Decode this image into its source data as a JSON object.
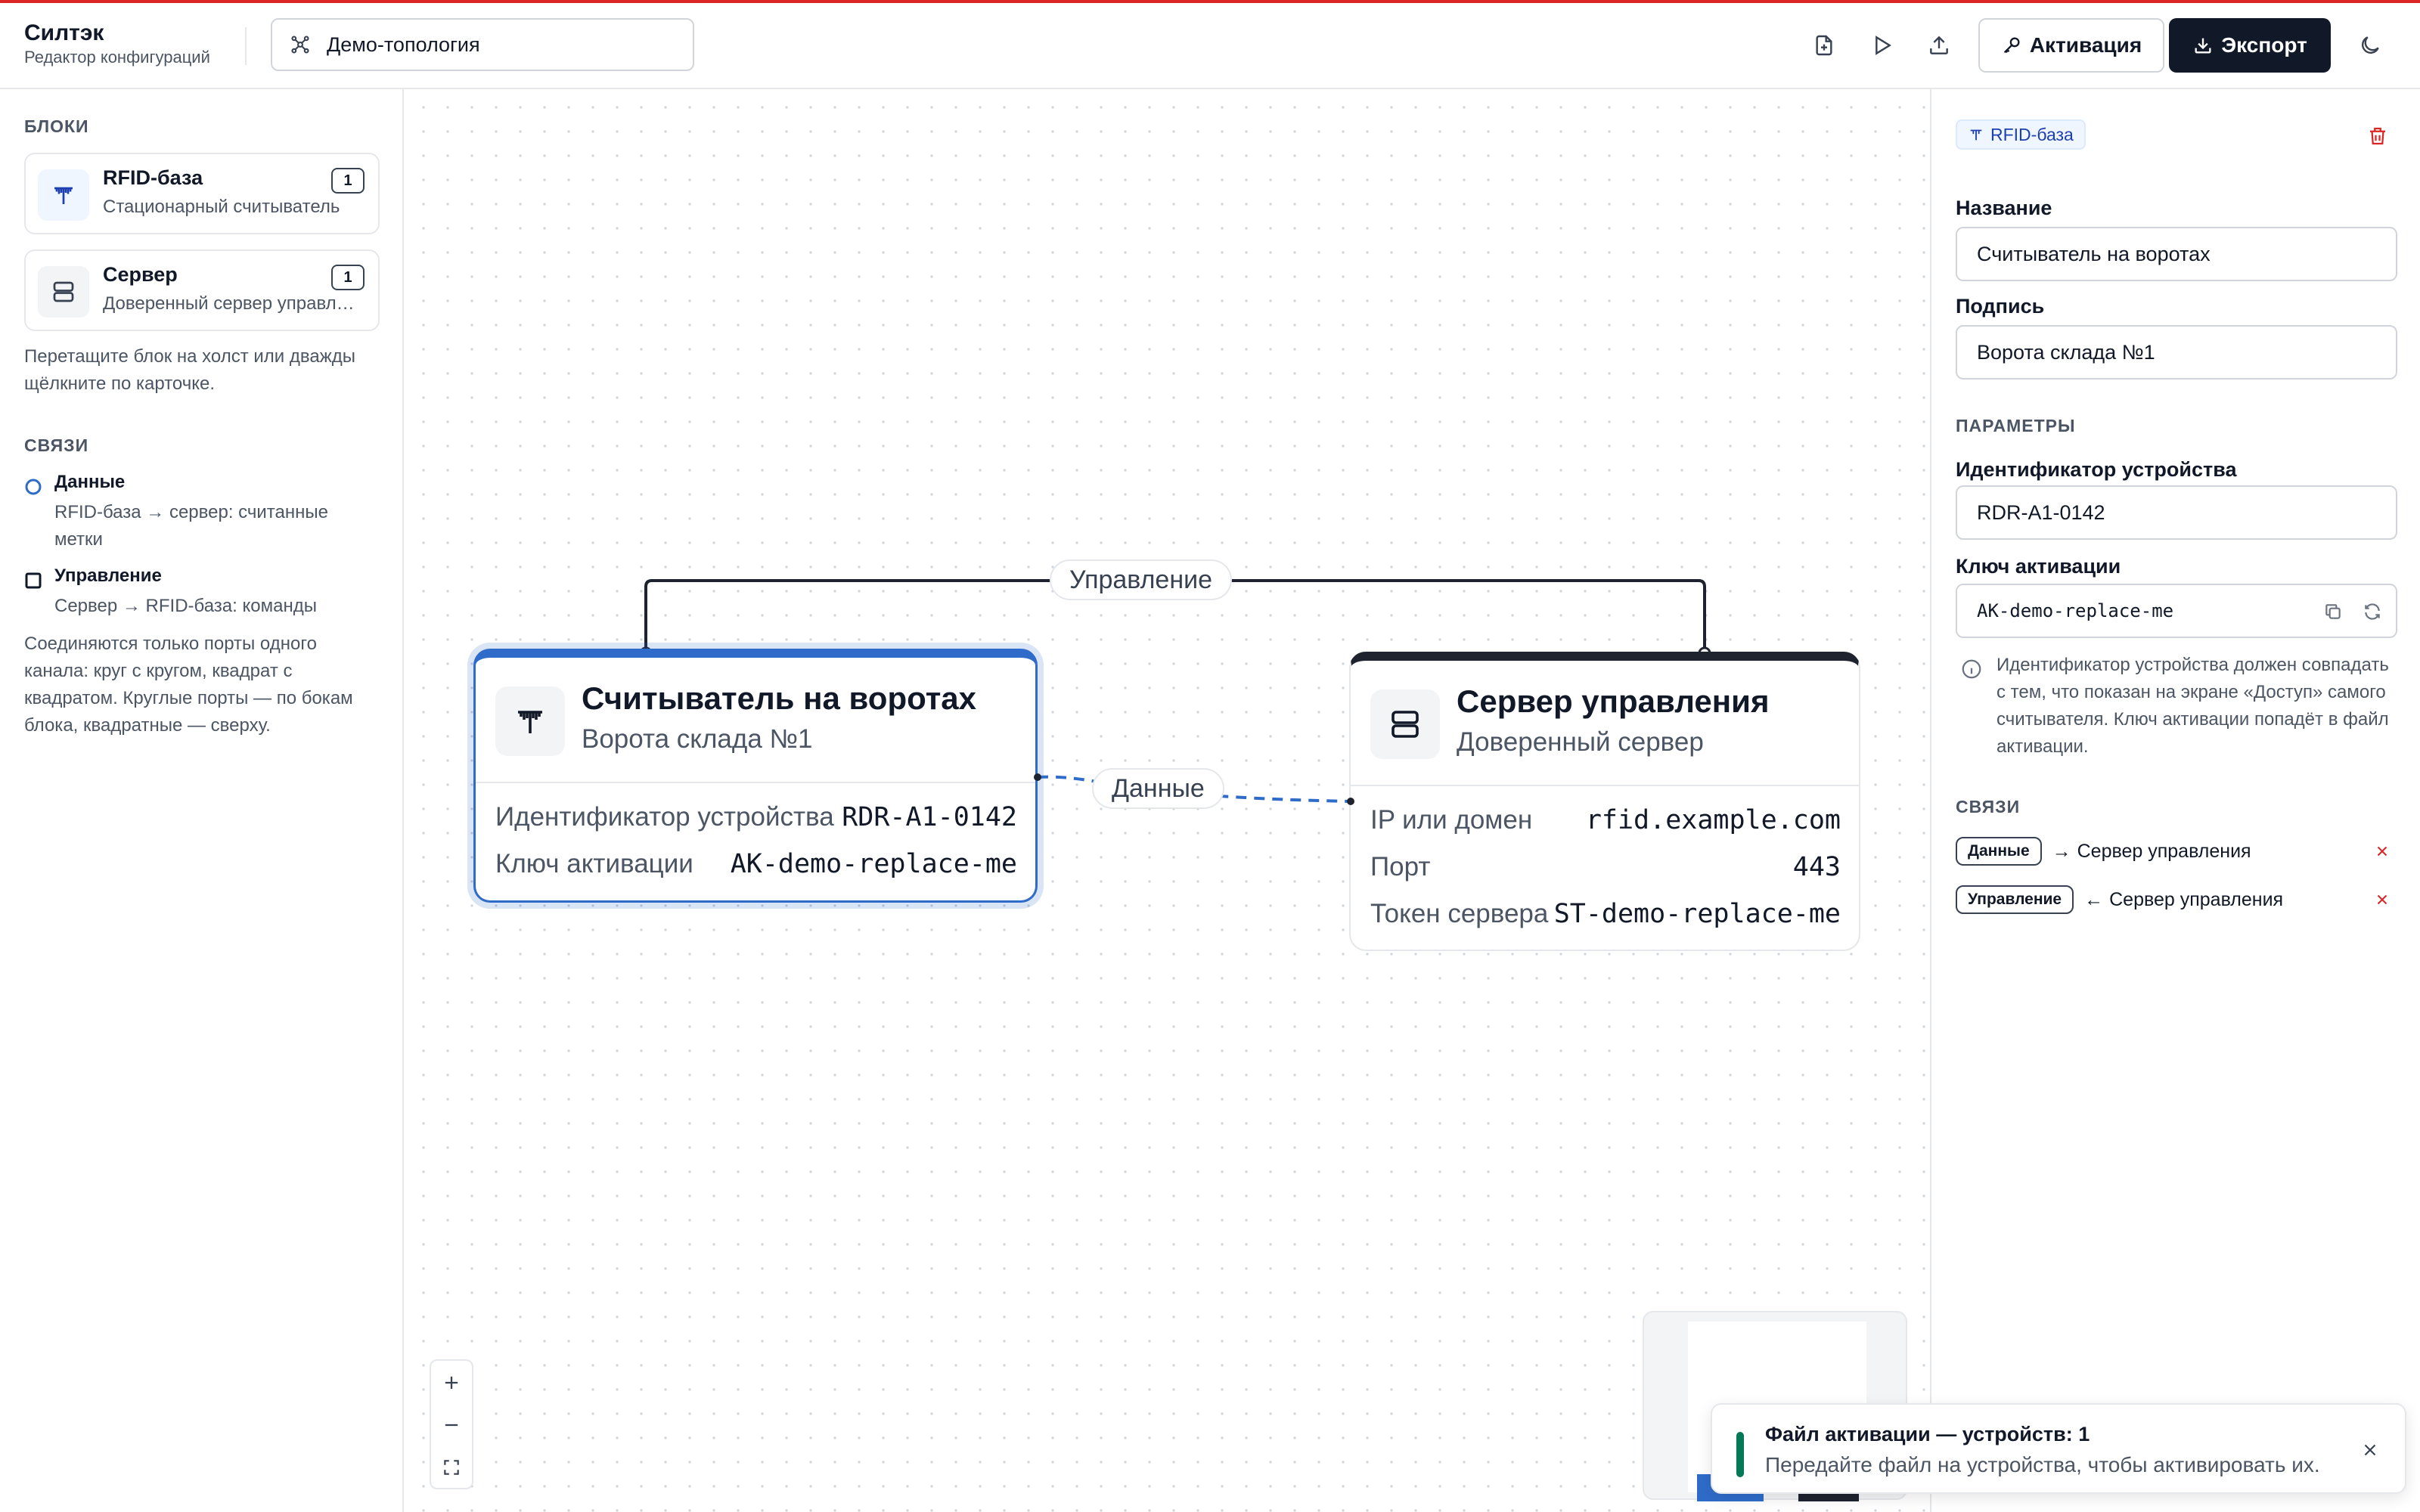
{
  "app": {
    "name": "Силтэк",
    "subtitle": "Редактор конфигураций",
    "topology_name": "Демо-топология",
    "activate_label": "Активация",
    "export_label": "Экспорт"
  },
  "sidebar": {
    "blocks_title": "БЛОКИ",
    "blocks": [
      {
        "name": "RFID-база",
        "desc": "Стационарный считыватель",
        "count": "1",
        "icon": "antenna-icon"
      },
      {
        "name": "Сервер",
        "desc": "Доверенный сервер управл…",
        "count": "1",
        "icon": "server-icon"
      }
    ],
    "blocks_hint": "Перетащите блок на холст или дважды щёлкните по карточке.",
    "links_title": "СВЯЗИ",
    "links": [
      {
        "name": "Данные",
        "desc": "RFID-база → сервер: считанные метки",
        "marker": "circle"
      },
      {
        "name": "Управление",
        "desc": "Сервер → RFID-база: команды",
        "marker": "square"
      }
    ],
    "links_hint": "Соединяются только порты одного канала: круг с кругом, квадрат с квадратом. Круглые порты — по бокам блока, квадратные — сверху."
  },
  "canvas": {
    "edges": {
      "control_label": "Управление",
      "data_label": "Данные"
    },
    "nodes": [
      {
        "title": "Считыватель на воротах",
        "subtitle": "Ворота склада №1",
        "icon": "antenna-icon",
        "props": [
          {
            "key": "Идентификатор устройства",
            "value": "RDR-A1-0142"
          },
          {
            "key": "Ключ активации",
            "value": "AK-demo-replace-me"
          }
        ]
      },
      {
        "title": "Сервер управления",
        "subtitle": "Доверенный сервер",
        "icon": "server-icon",
        "props": [
          {
            "key": "IP или домен",
            "value": "rfid.example.com"
          },
          {
            "key": "Порт",
            "value": "443"
          },
          {
            "key": "Токен сервера",
            "value": "ST-demo-replace-me"
          }
        ]
      }
    ]
  },
  "toast": {
    "title": "Файл активации — устройств: 1",
    "body": "Передайте файл на устройства, чтобы активировать их."
  },
  "inspector": {
    "type_badge": "RFID-база",
    "name_label": "Название",
    "name_value": "Считыватель на воротах",
    "caption_label": "Подпись",
    "caption_value": "Ворота склада №1",
    "params_title": "ПАРАМЕТРЫ",
    "device_id_label": "Идентификатор устройства",
    "device_id_value": "RDR-A1-0142",
    "activation_key_label": "Ключ активации",
    "activation_key_value": "AK-demo-replace-me",
    "note": "Идентификатор устройства должен совпадать с тем, что показан на экране «Доступ» самого считывателя. Ключ активации попадёт в файл активации.",
    "links_title": "СВЯЗИ",
    "connections": [
      {
        "channel": "Данные",
        "direction": "→",
        "target": "Сервер управления"
      },
      {
        "channel": "Управление",
        "direction": "←",
        "target": "Сервер управления"
      }
    ]
  },
  "colors": {
    "accent_red": "#dc2626",
    "selected_blue": "#2f6cc9",
    "dark": "#111827",
    "success_green": "#047857"
  }
}
